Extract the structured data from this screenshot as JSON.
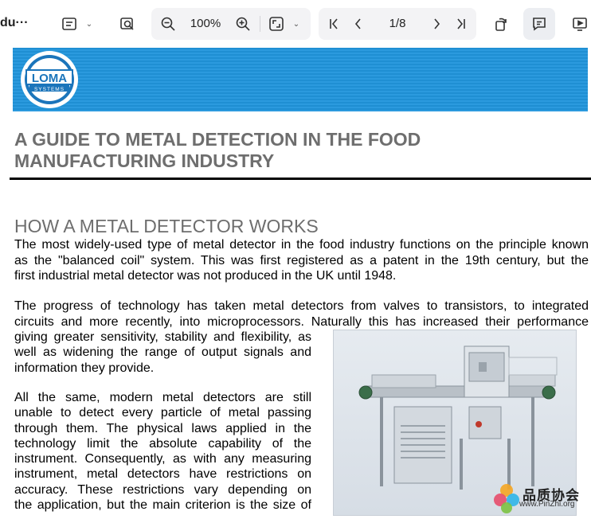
{
  "toolbar": {
    "doc_title": "du···",
    "zoom_value": "100%",
    "page_indicator": "1/8"
  },
  "logo": {
    "brand": "LOMA",
    "subtitle": "SYSTEMS"
  },
  "document": {
    "title_line1": "A GUIDE TO METAL DETECTION IN THE FOOD",
    "title_line2": "MANUFACTURING INDUSTRY",
    "section_heading": "HOW A METAL DETECTOR WORKS",
    "para1": [
      "The most widely-used type of metal detector in the food industry functions on the principle known",
      "as the \"balanced coil\" system. This was first registered as a patent in the 19th century, but the",
      "first industrial metal detector was not produced in the UK until 1948."
    ],
    "para2": [
      "The progress of technology has taken metal detectors from valves to transistors, to integrated",
      "circuits and more recently, into microprocessors. Naturally this has increased their performance"
    ],
    "para2_cont": [
      "giving greater sensitivity, stability and flexibility, as",
      "well as widening the range of output signals and",
      "information they provide."
    ],
    "para3": [
      "All the same, modern metal detectors are still",
      "unable to detect every particle of metal passing",
      "through them. The physical laws applied in the",
      "technology limit the absolute capability of the",
      "instrument. Consequently, as with any measuring",
      "instrument, metal detectors have restrictions on",
      "accuracy. These restrictions vary depending on",
      "the application, but the main criterion is the size of"
    ]
  },
  "watermark": {
    "cn_text": "品质协会",
    "url": "www.PinZhi.org"
  }
}
